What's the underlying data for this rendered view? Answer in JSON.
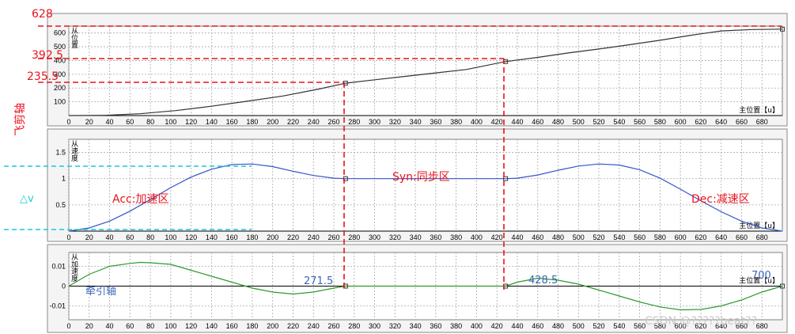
{
  "chart_data": [
    {
      "type": "line",
      "name": "slave-position",
      "ylabel": "从位置",
      "x_unit_label": "主位置【u】",
      "xlim": [
        0,
        700
      ],
      "ylim": [
        0,
        650
      ],
      "x_ticks": [
        0,
        20,
        40,
        60,
        80,
        100,
        120,
        140,
        160,
        180,
        200,
        220,
        240,
        260,
        280,
        300,
        320,
        340,
        360,
        380,
        400,
        420,
        440,
        460,
        480,
        500,
        520,
        540,
        560,
        580,
        600,
        620,
        640,
        660,
        680
      ],
      "y_ticks": [
        100,
        200,
        300,
        400,
        500,
        600
      ],
      "series": [
        {
          "color": "#333333",
          "x": [
            0,
            35,
            70,
            105,
            140,
            175,
            210,
            245,
            271.5,
            300,
            330,
            360,
            390,
            428.5,
            460,
            490,
            520,
            550,
            580,
            610,
            640,
            670,
            700
          ],
          "y": [
            0,
            2,
            13,
            36,
            68,
            104,
            142,
            192,
            235.5,
            260,
            285,
            310,
            335,
            392.5,
            423,
            455,
            484,
            515,
            547,
            583,
            615,
            625,
            628
          ]
        }
      ],
      "markers": [
        {
          "x": 271.5,
          "y": 235.5
        },
        {
          "x": 428.5,
          "y": 392.5
        },
        {
          "x": 700,
          "y": 628
        }
      ]
    },
    {
      "type": "line",
      "name": "slave-velocity",
      "ylabel": "从速度",
      "x_unit_label": "主位置【u】",
      "xlim": [
        0,
        700
      ],
      "ylim": [
        0,
        1.75
      ],
      "x_ticks": [
        0,
        20,
        40,
        60,
        80,
        100,
        120,
        140,
        160,
        180,
        200,
        220,
        240,
        260,
        280,
        300,
        320,
        340,
        360,
        380,
        400,
        420,
        440,
        460,
        480,
        500,
        520,
        540,
        560,
        580,
        600,
        620,
        640,
        660,
        680
      ],
      "y_ticks": [
        0.5,
        1,
        1.5
      ],
      "y_tick_labels": [
        "0.5",
        "1",
        "1.5"
      ],
      "series": [
        {
          "color": "#3455c8",
          "x": [
            0,
            20,
            40,
            60,
            80,
            100,
            120,
            140,
            160,
            180,
            200,
            220,
            240,
            260,
            271.5,
            428.5,
            440,
            460,
            480,
            500,
            520,
            540,
            560,
            580,
            600,
            620,
            640,
            660,
            680,
            700
          ],
          "y": [
            0,
            0.06,
            0.19,
            0.38,
            0.6,
            0.83,
            1.03,
            1.18,
            1.27,
            1.28,
            1.23,
            1.14,
            1.06,
            1.01,
            1.0,
            1.0,
            1.01,
            1.07,
            1.16,
            1.24,
            1.28,
            1.26,
            1.17,
            1.01,
            0.8,
            0.58,
            0.37,
            0.19,
            0.06,
            0
          ]
        }
      ],
      "markers": [
        {
          "x": 271.5,
          "y": 1.0
        },
        {
          "x": 428.5,
          "y": 1.0
        }
      ]
    },
    {
      "type": "line",
      "name": "slave-acceleration",
      "ylabel": "从加速度",
      "x_unit_label": "主位置【u】",
      "xlim": [
        0,
        700
      ],
      "ylim": [
        -0.017,
        0.017
      ],
      "x_ticks": [
        0,
        20,
        40,
        60,
        80,
        100,
        120,
        140,
        160,
        180,
        200,
        220,
        240,
        260,
        280,
        300,
        320,
        340,
        360,
        380,
        400,
        420,
        440,
        460,
        480,
        500,
        520,
        540,
        560,
        580,
        600,
        620,
        640,
        660,
        680
      ],
      "y_ticks": [
        -0.01,
        0,
        0.01
      ],
      "y_tick_labels": [
        "-0.01",
        "0",
        "0.01"
      ],
      "series": [
        {
          "color": "#2e9a2e",
          "x": [
            0,
            20,
            40,
            60,
            70,
            80,
            100,
            120,
            140,
            160,
            180,
            200,
            220,
            240,
            260,
            271.5,
            428.5,
            440,
            460,
            480,
            500,
            520,
            540,
            560,
            580,
            600,
            620,
            640,
            660,
            680,
            700
          ],
          "y": [
            0,
            0.006,
            0.01,
            0.0115,
            0.012,
            0.0118,
            0.011,
            0.008,
            0.005,
            0.002,
            -0.001,
            -0.003,
            -0.004,
            -0.003,
            -0.001,
            0,
            0,
            0.002,
            0.004,
            0.003,
            0.001,
            -0.002,
            -0.005,
            -0.008,
            -0.0105,
            -0.012,
            -0.0118,
            -0.01,
            -0.007,
            -0.003,
            0
          ]
        }
      ],
      "markers": [
        {
          "x": 271.5,
          "y": 0
        },
        {
          "x": 428.5,
          "y": 0
        },
        {
          "x": 700,
          "y": 0
        }
      ]
    }
  ],
  "annotations": {
    "pos_628": "628",
    "pos_392": "392.5",
    "pos_235": "235.5",
    "flying_shear_axis": "飞剪轴",
    "delta_v": "△v",
    "acc_zone": "Acc:加速区",
    "syn_zone": "Syn:同步区",
    "dec_zone": "Dec:减速区",
    "traction_axis": "牵引轴",
    "master_271": "271.5",
    "master_428": "428.5",
    "master_700": "700",
    "watermark": "CSDN @?????beat??"
  },
  "colors": {
    "annotation_red": "#e8141e",
    "annotation_blue": "#3b66b8",
    "annotation_cyan": "#1cc9d6",
    "grid": "#a9a9a9",
    "frame": "#7f7f7f"
  }
}
